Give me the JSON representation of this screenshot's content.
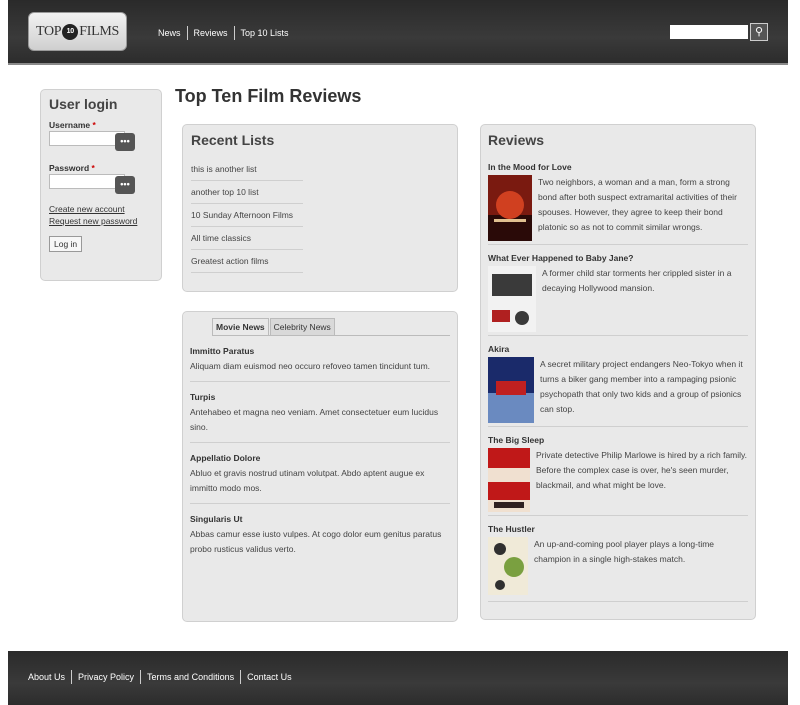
{
  "header": {
    "logo": {
      "left_text": "TOP",
      "reel_text": "10",
      "right_text": "FILMS"
    },
    "nav": [
      "News",
      "Reviews",
      "Top 10 Lists"
    ],
    "search": {
      "placeholder": "",
      "button_icon": "search-icon"
    }
  },
  "login": {
    "title": "User login",
    "username_label": "Username",
    "password_label": "Password",
    "required_mark": "*",
    "create_account": "Create new account",
    "request_password": "Request new password",
    "submit": "Log in"
  },
  "page_title": "Top Ten Film Reviews",
  "recent": {
    "title": "Recent Lists",
    "items": [
      "this is another list",
      "another top 10 list",
      "10 Sunday Afternoon Films",
      "All time classics",
      "Greatest action films"
    ]
  },
  "news": {
    "tabs": [
      "Movie News",
      "Celebrity News"
    ],
    "items": [
      {
        "title": "Immitto Paratus",
        "body": "Aliquam diam euismod neo occuro refoveo tamen tincidunt tum."
      },
      {
        "title": "Turpis",
        "body": "Antehabeo et magna neo veniam. Amet consectetuer eum lucidus sino."
      },
      {
        "title": "Appellatio Dolore",
        "body": "Abluo et gravis nostrud utinam volutpat. Abdo aptent augue ex immitto modo mos."
      },
      {
        "title": "Singularis Ut",
        "body": "Abbas camur esse iusto vulpes. At cogo dolor eum genitus paratus probo rusticus validus verto."
      }
    ]
  },
  "reviews": {
    "title": "Reviews",
    "items": [
      {
        "title": "In the Mood for Love",
        "body": "Two neighbors, a woman and a man, form a strong bond after both suspect extramarital activities of their spouses. However, they agree to keep their bond platonic so as not to commit similar wrongs.",
        "poster_colors": [
          "#7a1a10",
          "#d04020",
          "#2a0a08"
        ]
      },
      {
        "title": "What Ever Happened to Baby Jane?",
        "body": "A former child star torments her crippled sister in a decaying Hollywood mansion.",
        "poster_colors": [
          "#f2f2f2",
          "#3a3a3a",
          "#b02020"
        ]
      },
      {
        "title": "Akira",
        "body": "A secret military project endangers Neo-Tokyo when it turns a biker gang member into a rampaging psionic psychopath that only two kids and a group of psionics can stop.",
        "poster_colors": [
          "#1a2a6a",
          "#c02020",
          "#6a8ac0"
        ]
      },
      {
        "title": "The Big Sleep",
        "body": "Private detective Philip Marlowe is hired by a rich family. Before the complex case is over, he's seen murder, blackmail, and what might be love.",
        "poster_colors": [
          "#c01818",
          "#f0e0d0",
          "#302020"
        ]
      },
      {
        "title": "The Hustler",
        "body": "An up-and-coming pool player plays a long-time champion in a single high-stakes match.",
        "poster_colors": [
          "#f0ead8",
          "#7aa040",
          "#303030"
        ]
      }
    ]
  },
  "footer": {
    "links": [
      "About Us",
      "Privacy Policy",
      "Terms and Conditions",
      "Contact Us"
    ]
  }
}
